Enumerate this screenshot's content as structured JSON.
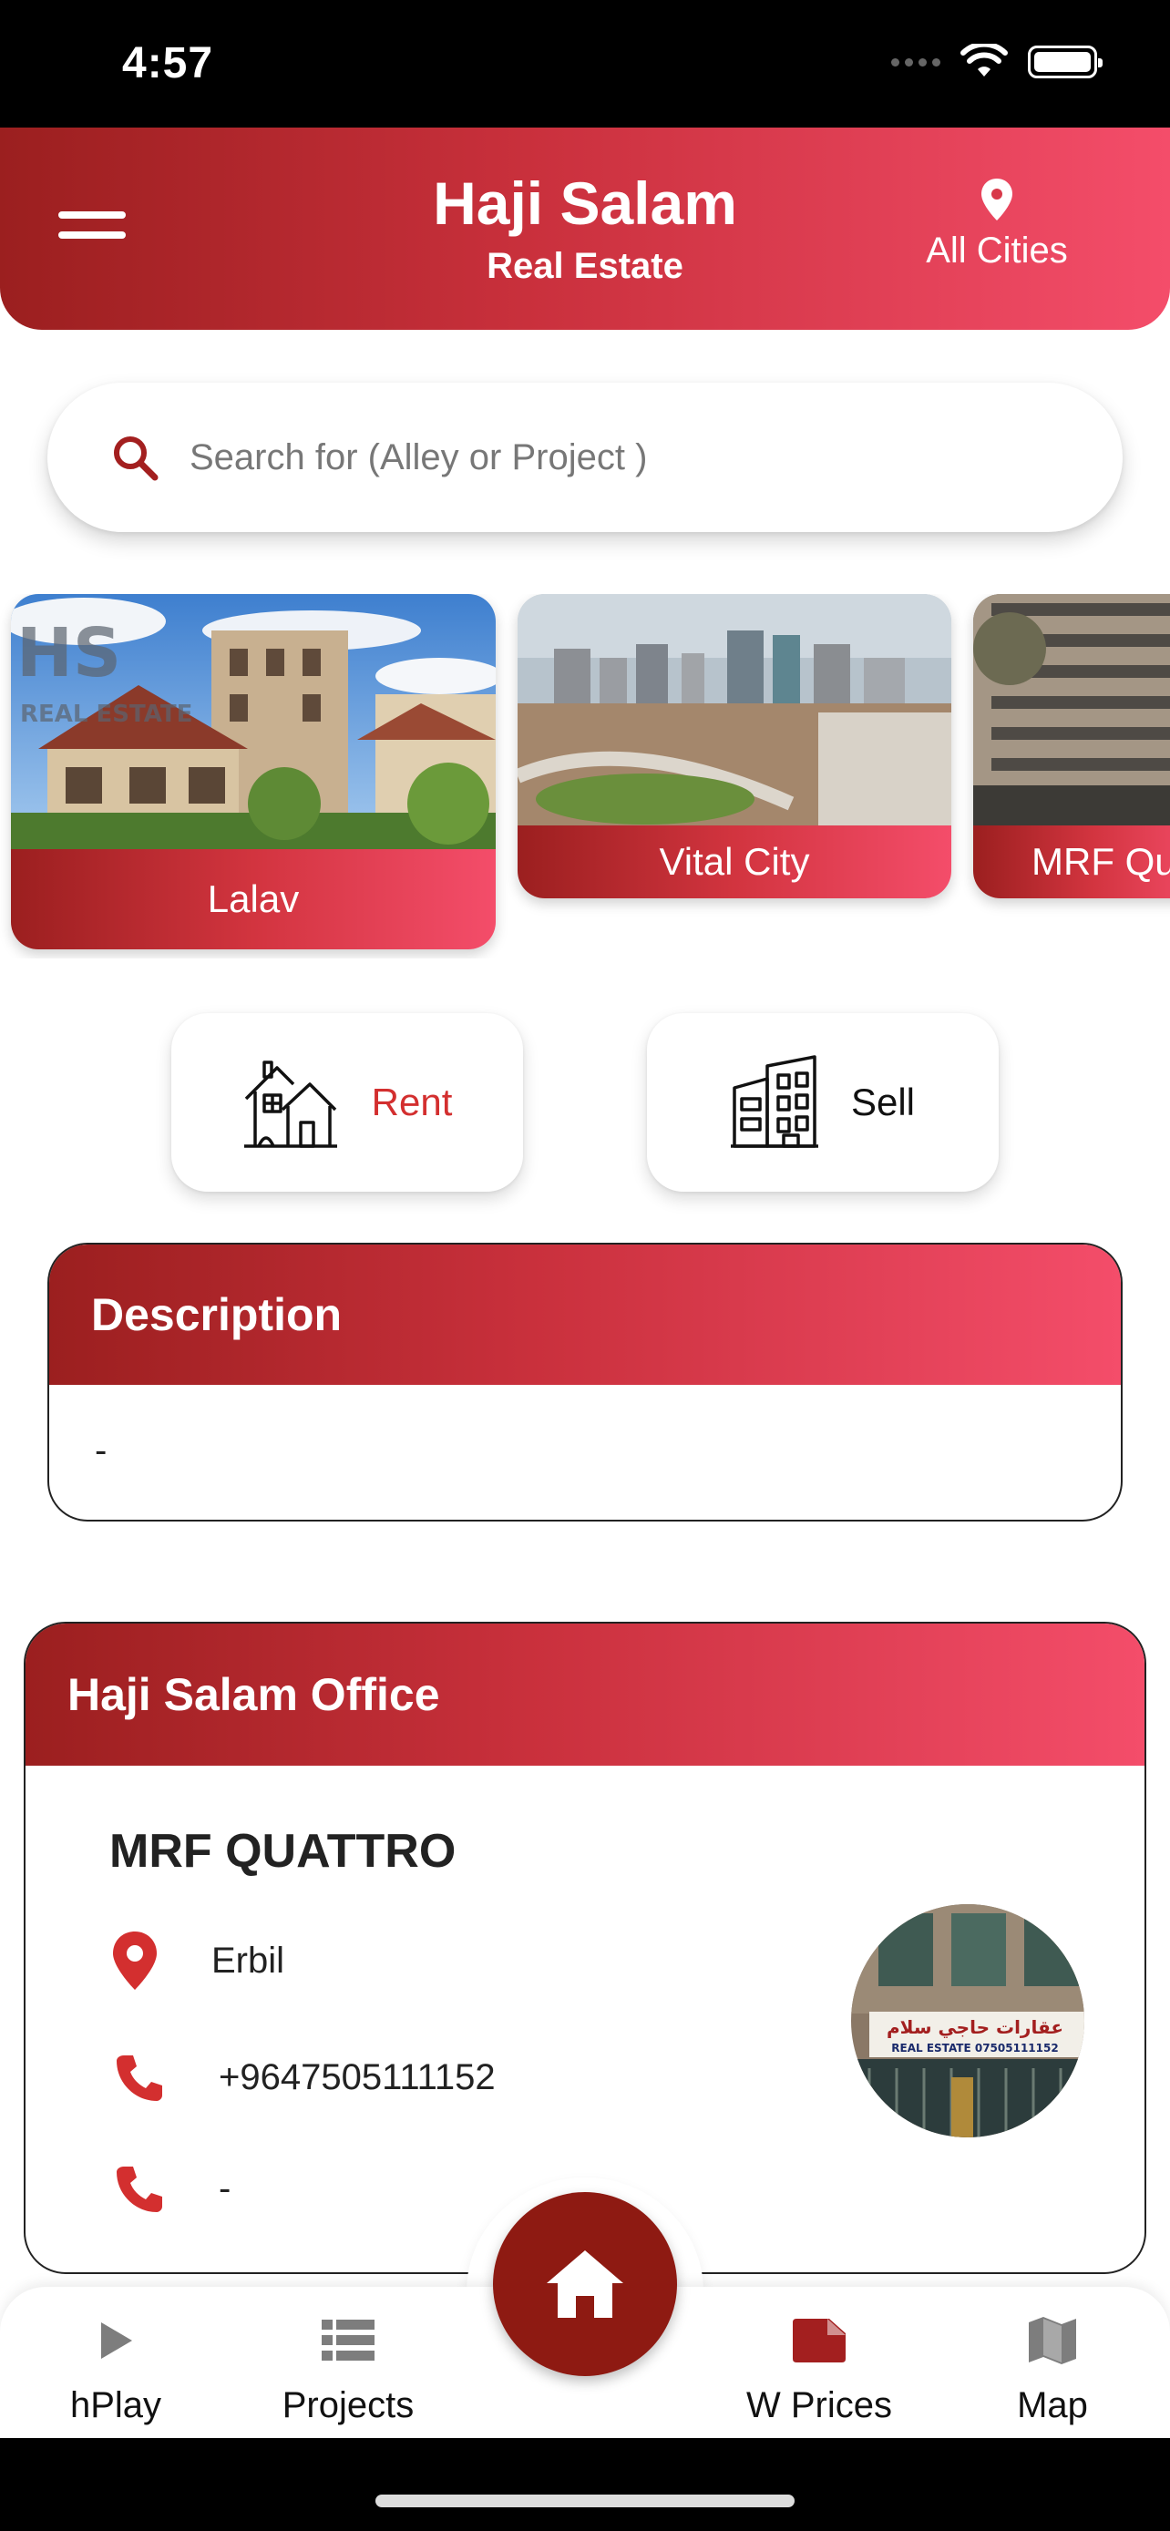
{
  "status_bar": {
    "time": "4:57"
  },
  "header": {
    "title": "Haji Salam",
    "subtitle": "Real Estate",
    "location_label": "All Cities"
  },
  "search": {
    "placeholder": "Search for (Alley or Project )"
  },
  "projects": [
    {
      "name": "Lalav",
      "watermark": "HS REAL ESTATE"
    },
    {
      "name": "Vital City"
    },
    {
      "name": "MRF Qua"
    }
  ],
  "listing_types": [
    {
      "label": "Rent",
      "icon": "house-icon",
      "color": "#d32f2f"
    },
    {
      "label": "Sell",
      "icon": "building-icon",
      "color": "#111111"
    }
  ],
  "description": {
    "heading": "Description",
    "body": "-"
  },
  "office": {
    "heading": "Haji Salam Office",
    "name": "MRF QUATTRO",
    "city": "Erbil",
    "phone1": "+9647505111152",
    "phone2": "-",
    "photo_sign_arabic": "عقارات حاجي سلام",
    "photo_sign_latin": "REAL ESTATE 07505111152"
  },
  "bottom_nav": {
    "items": [
      {
        "label": "hPlay",
        "icon": "play-icon"
      },
      {
        "label": "Projects",
        "icon": "list-icon"
      },
      {
        "label": "W Prices",
        "icon": "tag-icon"
      },
      {
        "label": "Map",
        "icon": "map-icon"
      }
    ],
    "center": "home-icon"
  },
  "colors": {
    "brand_dark": "#9b1f1f",
    "brand_light": "#f44d6a",
    "accent_red": "#d32f2f",
    "home_button": "#8e1a12"
  }
}
